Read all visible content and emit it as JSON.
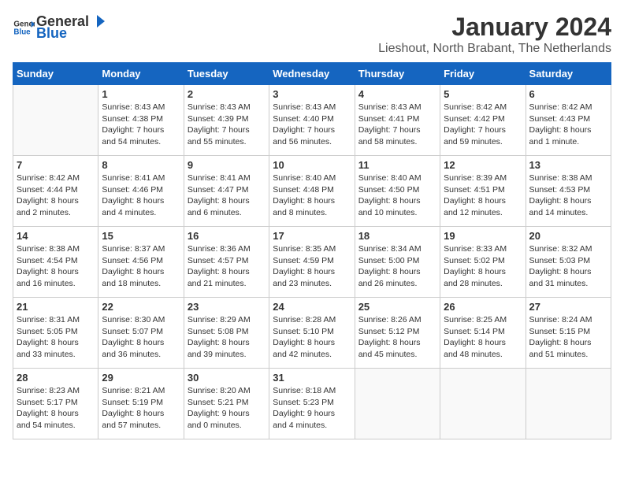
{
  "header": {
    "logo_general": "General",
    "logo_blue": "Blue",
    "title": "January 2024",
    "subtitle": "Lieshout, North Brabant, The Netherlands"
  },
  "days_of_week": [
    "Sunday",
    "Monday",
    "Tuesday",
    "Wednesday",
    "Thursday",
    "Friday",
    "Saturday"
  ],
  "weeks": [
    [
      {
        "day": "",
        "info": ""
      },
      {
        "day": "1",
        "info": "Sunrise: 8:43 AM\nSunset: 4:38 PM\nDaylight: 7 hours\nand 54 minutes."
      },
      {
        "day": "2",
        "info": "Sunrise: 8:43 AM\nSunset: 4:39 PM\nDaylight: 7 hours\nand 55 minutes."
      },
      {
        "day": "3",
        "info": "Sunrise: 8:43 AM\nSunset: 4:40 PM\nDaylight: 7 hours\nand 56 minutes."
      },
      {
        "day": "4",
        "info": "Sunrise: 8:43 AM\nSunset: 4:41 PM\nDaylight: 7 hours\nand 58 minutes."
      },
      {
        "day": "5",
        "info": "Sunrise: 8:42 AM\nSunset: 4:42 PM\nDaylight: 7 hours\nand 59 minutes."
      },
      {
        "day": "6",
        "info": "Sunrise: 8:42 AM\nSunset: 4:43 PM\nDaylight: 8 hours\nand 1 minute."
      }
    ],
    [
      {
        "day": "7",
        "info": "Sunrise: 8:42 AM\nSunset: 4:44 PM\nDaylight: 8 hours\nand 2 minutes."
      },
      {
        "day": "8",
        "info": "Sunrise: 8:41 AM\nSunset: 4:46 PM\nDaylight: 8 hours\nand 4 minutes."
      },
      {
        "day": "9",
        "info": "Sunrise: 8:41 AM\nSunset: 4:47 PM\nDaylight: 8 hours\nand 6 minutes."
      },
      {
        "day": "10",
        "info": "Sunrise: 8:40 AM\nSunset: 4:48 PM\nDaylight: 8 hours\nand 8 minutes."
      },
      {
        "day": "11",
        "info": "Sunrise: 8:40 AM\nSunset: 4:50 PM\nDaylight: 8 hours\nand 10 minutes."
      },
      {
        "day": "12",
        "info": "Sunrise: 8:39 AM\nSunset: 4:51 PM\nDaylight: 8 hours\nand 12 minutes."
      },
      {
        "day": "13",
        "info": "Sunrise: 8:38 AM\nSunset: 4:53 PM\nDaylight: 8 hours\nand 14 minutes."
      }
    ],
    [
      {
        "day": "14",
        "info": "Sunrise: 8:38 AM\nSunset: 4:54 PM\nDaylight: 8 hours\nand 16 minutes."
      },
      {
        "day": "15",
        "info": "Sunrise: 8:37 AM\nSunset: 4:56 PM\nDaylight: 8 hours\nand 18 minutes."
      },
      {
        "day": "16",
        "info": "Sunrise: 8:36 AM\nSunset: 4:57 PM\nDaylight: 8 hours\nand 21 minutes."
      },
      {
        "day": "17",
        "info": "Sunrise: 8:35 AM\nSunset: 4:59 PM\nDaylight: 8 hours\nand 23 minutes."
      },
      {
        "day": "18",
        "info": "Sunrise: 8:34 AM\nSunset: 5:00 PM\nDaylight: 8 hours\nand 26 minutes."
      },
      {
        "day": "19",
        "info": "Sunrise: 8:33 AM\nSunset: 5:02 PM\nDaylight: 8 hours\nand 28 minutes."
      },
      {
        "day": "20",
        "info": "Sunrise: 8:32 AM\nSunset: 5:03 PM\nDaylight: 8 hours\nand 31 minutes."
      }
    ],
    [
      {
        "day": "21",
        "info": "Sunrise: 8:31 AM\nSunset: 5:05 PM\nDaylight: 8 hours\nand 33 minutes."
      },
      {
        "day": "22",
        "info": "Sunrise: 8:30 AM\nSunset: 5:07 PM\nDaylight: 8 hours\nand 36 minutes."
      },
      {
        "day": "23",
        "info": "Sunrise: 8:29 AM\nSunset: 5:08 PM\nDaylight: 8 hours\nand 39 minutes."
      },
      {
        "day": "24",
        "info": "Sunrise: 8:28 AM\nSunset: 5:10 PM\nDaylight: 8 hours\nand 42 minutes."
      },
      {
        "day": "25",
        "info": "Sunrise: 8:26 AM\nSunset: 5:12 PM\nDaylight: 8 hours\nand 45 minutes."
      },
      {
        "day": "26",
        "info": "Sunrise: 8:25 AM\nSunset: 5:14 PM\nDaylight: 8 hours\nand 48 minutes."
      },
      {
        "day": "27",
        "info": "Sunrise: 8:24 AM\nSunset: 5:15 PM\nDaylight: 8 hours\nand 51 minutes."
      }
    ],
    [
      {
        "day": "28",
        "info": "Sunrise: 8:23 AM\nSunset: 5:17 PM\nDaylight: 8 hours\nand 54 minutes."
      },
      {
        "day": "29",
        "info": "Sunrise: 8:21 AM\nSunset: 5:19 PM\nDaylight: 8 hours\nand 57 minutes."
      },
      {
        "day": "30",
        "info": "Sunrise: 8:20 AM\nSunset: 5:21 PM\nDaylight: 9 hours\nand 0 minutes."
      },
      {
        "day": "31",
        "info": "Sunrise: 8:18 AM\nSunset: 5:23 PM\nDaylight: 9 hours\nand 4 minutes."
      },
      {
        "day": "",
        "info": ""
      },
      {
        "day": "",
        "info": ""
      },
      {
        "day": "",
        "info": ""
      }
    ]
  ]
}
